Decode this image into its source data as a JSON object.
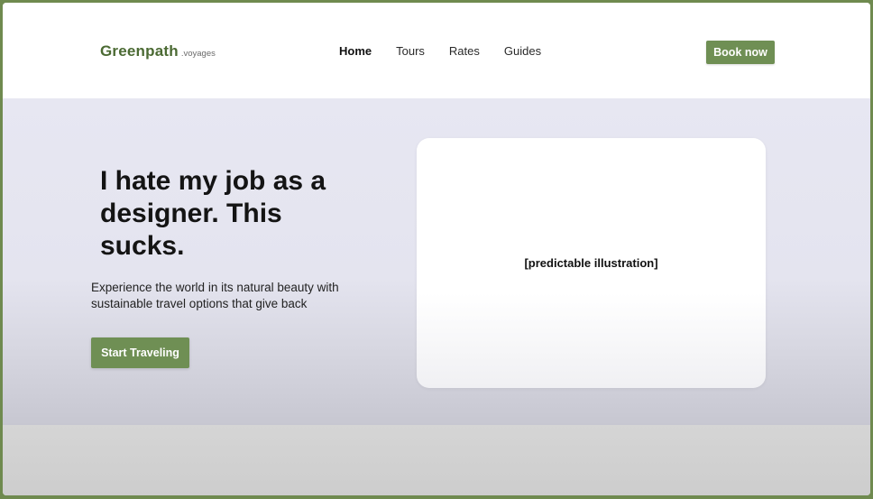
{
  "header": {
    "logo_main": "Greenpath",
    "logo_sub": ".voyages",
    "nav": [
      {
        "label": "Home",
        "active": true
      },
      {
        "label": "Tours",
        "active": false
      },
      {
        "label": "Rates",
        "active": false
      },
      {
        "label": "Guides",
        "active": false
      }
    ],
    "book_label": "Book now"
  },
  "hero": {
    "title": "I hate my job as a designer. This sucks.",
    "subtitle": "Experience the world in its natural beauty with sustainable travel options that give back",
    "cta_label": "Start Traveling",
    "illustration_label": "[predictable illustration]"
  },
  "colors": {
    "brand_green": "#6f8f54",
    "logo_green": "#4b6a33",
    "hero_bg": "#e7e7f2",
    "frame_border": "#6f8a4f"
  }
}
